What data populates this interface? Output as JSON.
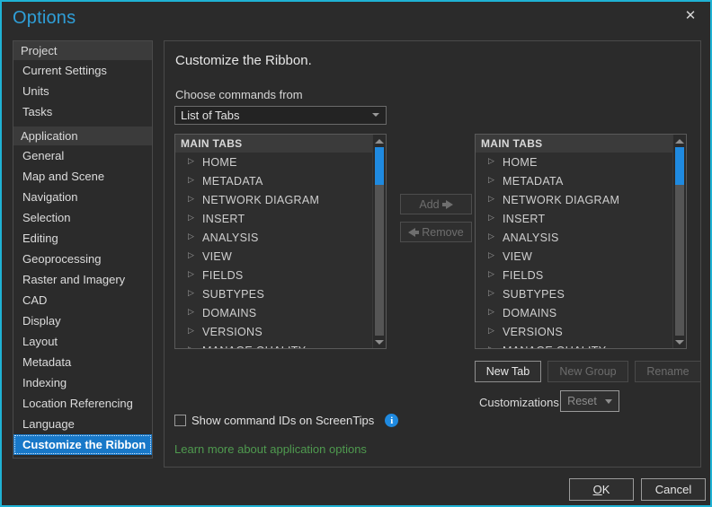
{
  "window": {
    "title": "Options",
    "close_icon": "close-icon",
    "accent_color": "#1fb2d4"
  },
  "nav": {
    "groups": [
      {
        "header": "Project",
        "items": [
          {
            "label": "Current Settings",
            "selected": false
          },
          {
            "label": "Units",
            "selected": false
          },
          {
            "label": "Tasks",
            "selected": false
          }
        ]
      },
      {
        "header": "Application",
        "items": [
          {
            "label": "General",
            "selected": false
          },
          {
            "label": "Map and Scene",
            "selected": false
          },
          {
            "label": "Navigation",
            "selected": false
          },
          {
            "label": "Selection",
            "selected": false
          },
          {
            "label": "Editing",
            "selected": false
          },
          {
            "label": "Geoprocessing",
            "selected": false
          },
          {
            "label": "Raster and Imagery",
            "selected": false
          },
          {
            "label": "CAD",
            "selected": false
          },
          {
            "label": "Display",
            "selected": false
          },
          {
            "label": "Layout",
            "selected": false
          },
          {
            "label": "Metadata",
            "selected": false
          },
          {
            "label": "Indexing",
            "selected": false
          },
          {
            "label": "Location Referencing",
            "selected": false
          },
          {
            "label": "Language",
            "selected": false
          },
          {
            "label": "Customize the Ribbon",
            "selected": true
          }
        ]
      }
    ]
  },
  "content": {
    "heading": "Customize the Ribbon.",
    "choose_label": "Choose commands from",
    "combo": {
      "value": "List of Tabs",
      "arrow_icon": "chevron-down-icon"
    },
    "left_list": {
      "header": "MAIN TABS",
      "items": [
        "HOME",
        "METADATA",
        "NETWORK DIAGRAM",
        "INSERT",
        "ANALYSIS",
        "VIEW",
        "FIELDS",
        "SUBTYPES",
        "DOMAINS",
        "VERSIONS",
        "MANAGE QUALITY"
      ],
      "expander_icon": "triangle-right-icon"
    },
    "right_list": {
      "header": "MAIN TABS",
      "items": [
        "HOME",
        "METADATA",
        "NETWORK DIAGRAM",
        "INSERT",
        "ANALYSIS",
        "VIEW",
        "FIELDS",
        "SUBTYPES",
        "DOMAINS",
        "VERSIONS",
        "MANAGE QUALITY"
      ],
      "expander_icon": "triangle-right-icon"
    },
    "transfer": {
      "add_label": "Add",
      "add_enabled": false,
      "remove_label": "Remove",
      "remove_enabled": false
    },
    "tab_actions": {
      "new_tab_label": "New Tab",
      "new_group_label": "New Group",
      "rename_label": "Rename"
    },
    "customizations": {
      "label": "Customizations",
      "reset_label": "Reset",
      "reset_arrow_icon": "chevron-down-icon"
    },
    "checkbox": {
      "label": "Show command IDs on ScreenTips",
      "checked": false,
      "info_icon": "info-icon",
      "info_glyph": "i"
    },
    "learn_more": "Learn more about application options"
  },
  "footer": {
    "ok_accel": "O",
    "ok_rest": "K",
    "cancel_label": "Cancel"
  }
}
